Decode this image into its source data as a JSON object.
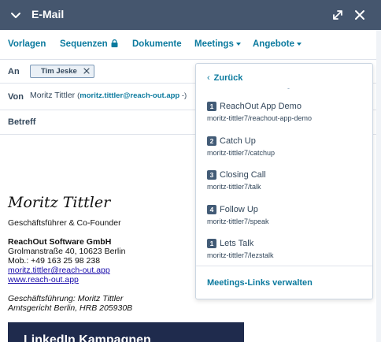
{
  "header": {
    "title": "E-Mail"
  },
  "toolbar": {
    "templates": "Vorlagen",
    "sequences": "Sequenzen",
    "documents": "Dokumente",
    "meetings": "Meetings",
    "offers": "Angebote"
  },
  "fields": {
    "to_label": "An",
    "to_recipient": "Tim Jeske",
    "from_label": "Von",
    "from_name": "Moritz Tittler",
    "from_address": "moritz.tittler@reach-out.app",
    "from_suffix": " -)",
    "subject_label": "Betreff"
  },
  "signature": {
    "name": "Moritz Tittler",
    "role": "Geschäftsführer & Co-Founder",
    "company": "ReachOut Software GmbH",
    "street": "Grolmanstraße 40, 10623 Berlin",
    "phone": "Mob.: +49 163 25 98 238",
    "email": "moritz.tittler@reach-out.app",
    "website": "www.reach-out.app",
    "management": "Geschäftsführung: Moritz Tittler",
    "court": "Amtsgericht Berlin, HRB 205930B",
    "banner_text": "LinkedIn Kampagnen"
  },
  "meetings_menu": {
    "back": "Zurück",
    "separator": "-",
    "items": [
      {
        "number": "1",
        "name": "ReachOut App Demo",
        "slug": "moritz-tittler7/reachout-app-demo"
      },
      {
        "number": "2",
        "name": "Catch Up",
        "slug": "moritz-tittler7/catchup"
      },
      {
        "number": "3",
        "name": "Closing Call",
        "slug": "moritz-tittler7/talk"
      },
      {
        "number": "4",
        "name": "Follow Up",
        "slug": "moritz-tittler7/speak"
      },
      {
        "number": "1",
        "name": "Lets Talk",
        "slug": "moritz-tittler7/lezstalk"
      }
    ],
    "manage": "Meetings-Links verwalten"
  },
  "colors": {
    "header_bg": "#45566e",
    "link": "#0b7a9e",
    "text": "#33475b"
  }
}
